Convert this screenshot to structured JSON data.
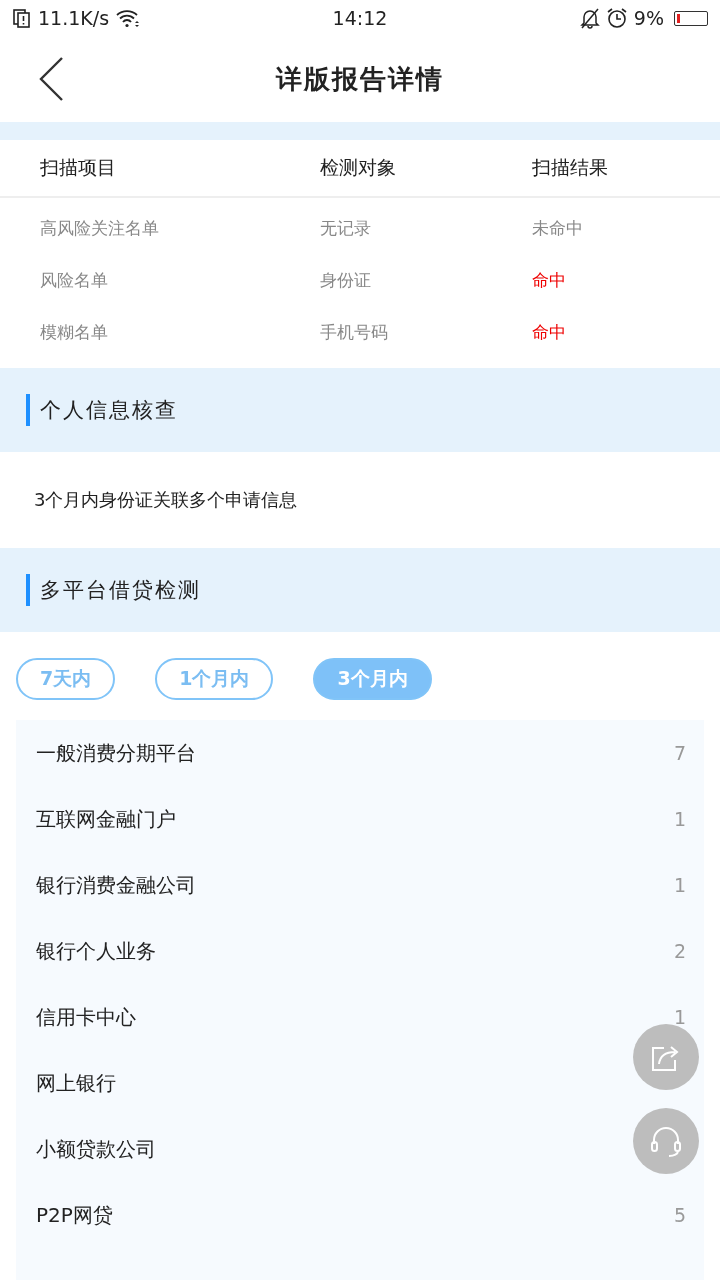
{
  "status_bar": {
    "speed": "11.1K/s",
    "time": "14:12",
    "battery_text": "9%",
    "battery": {
      "level": 0.09
    }
  },
  "header": {
    "title": "详版报告详情"
  },
  "scan_table": {
    "columns": [
      "扫描项目",
      "检测对象",
      "扫描结果"
    ],
    "rows": [
      {
        "item": "高风险关注名单",
        "target": "无记录",
        "result": "未命中",
        "hit": false
      },
      {
        "item": "风险名单",
        "target": "身份证",
        "result": "命中",
        "hit": true
      },
      {
        "item": "模糊名单",
        "target": "手机号码",
        "result": "命中",
        "hit": true
      }
    ]
  },
  "sections": [
    {
      "title": "个人信息核查",
      "text": "3个月内身份证关联多个申请信息"
    },
    {
      "title": "多平台借贷检测"
    }
  ],
  "tabs": [
    {
      "label": "7天内",
      "selected": false
    },
    {
      "label": "1个月内",
      "selected": false
    },
    {
      "label": "3个月内",
      "selected": true
    }
  ],
  "platforms": [
    {
      "name": "一般消费分期平台",
      "count": "7"
    },
    {
      "name": "互联网金融门户",
      "count": "1"
    },
    {
      "name": "银行消费金融公司",
      "count": "1"
    },
    {
      "name": "银行个人业务",
      "count": "2"
    },
    {
      "name": "信用卡中心",
      "count": "1"
    },
    {
      "name": "网上银行"
    },
    {
      "name": "小额贷款公司"
    },
    {
      "name": "P2P网贷",
      "count": "5"
    }
  ]
}
